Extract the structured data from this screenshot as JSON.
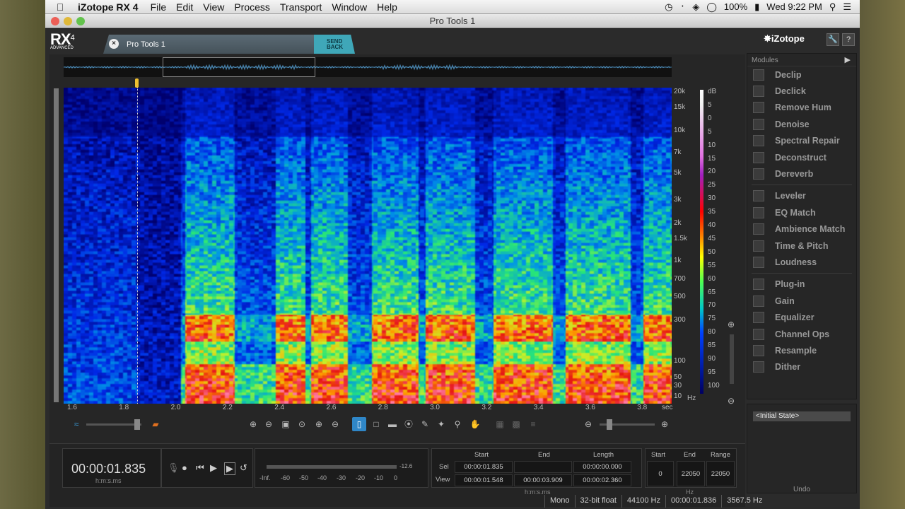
{
  "menubar": {
    "app": "iZotope RX 4",
    "items": [
      "File",
      "Edit",
      "View",
      "Process",
      "Transport",
      "Window",
      "Help"
    ],
    "battery": "100%",
    "clock": "Wed 9:22 PM"
  },
  "window": {
    "title": "Pro Tools 1"
  },
  "logo": {
    "text": "RX",
    "sup": "4",
    "sub": "ADVANCED"
  },
  "tab": {
    "label": "Pro Tools 1",
    "close": "×",
    "send_back": "SEND BACK"
  },
  "brand": "iZotope",
  "modules": {
    "header": "Modules",
    "groups": [
      [
        {
          "label": "Declip",
          "icon": "declip-icon"
        },
        {
          "label": "Declick",
          "icon": "declick-icon"
        },
        {
          "label": "Remove Hum",
          "icon": "hum-icon"
        },
        {
          "label": "Denoise",
          "icon": "denoise-icon"
        },
        {
          "label": "Spectral Repair",
          "icon": "repair-icon"
        },
        {
          "label": "Deconstruct",
          "icon": "deconstruct-icon"
        },
        {
          "label": "Dereverb",
          "icon": "dereverb-icon"
        }
      ],
      [
        {
          "label": "Leveler",
          "icon": "leveler-icon"
        },
        {
          "label": "EQ Match",
          "icon": "eq-match-icon"
        },
        {
          "label": "Ambience Match",
          "icon": "ambience-icon"
        },
        {
          "label": "Time & Pitch",
          "icon": "time-pitch-icon"
        },
        {
          "label": "Loudness",
          "icon": "loudness-icon"
        }
      ],
      [
        {
          "label": "Plug-in",
          "icon": "plugin-icon"
        },
        {
          "label": "Gain",
          "icon": "gain-icon"
        },
        {
          "label": "Equalizer",
          "icon": "equalizer-icon"
        },
        {
          "label": "Channel Ops",
          "icon": "channel-ops-icon"
        },
        {
          "label": "Resample",
          "icon": "resample-icon"
        },
        {
          "label": "Dither",
          "icon": "dither-icon"
        }
      ]
    ]
  },
  "undo": {
    "item": "<Initial State>",
    "label": "Undo"
  },
  "freq_axis": [
    "20k",
    "15k",
    "10k",
    "7k",
    "5k",
    "3k",
    "2k",
    "1.5k",
    "1k",
    "700",
    "500",
    "300",
    "100",
    "50",
    "30",
    "10",
    "Hz"
  ],
  "db_axis": [
    "dB",
    "5",
    "0",
    "5",
    "10",
    "15",
    "20",
    "25",
    "30",
    "35",
    "40",
    "45",
    "50",
    "55",
    "60",
    "65",
    "70",
    "75",
    "80",
    "85",
    "90",
    "95",
    "100"
  ],
  "time_axis": [
    "1.6",
    "1.8",
    "2.0",
    "2.2",
    "2.4",
    "2.6",
    "2.8",
    "3.0",
    "3.2",
    "3.4",
    "3.6",
    "3.8",
    "sec"
  ],
  "transport": {
    "time": "00:00:01.835",
    "time_unit": "h:m:s.ms",
    "meter_ticks": [
      "-Inf.",
      "-60",
      "-50",
      "-40",
      "-30",
      "-20",
      "-10",
      "0"
    ],
    "meter_peak": "-12.6"
  },
  "selection": {
    "headers": [
      "Start",
      "End",
      "Length"
    ],
    "sel_label": "Sel",
    "view_label": "View",
    "sel": [
      "00:00:01.835",
      "",
      "00:00:00.000"
    ],
    "view": [
      "00:00:01.548",
      "00:00:03.909",
      "00:00:02.360"
    ],
    "unit": "h:m:s.ms"
  },
  "range": {
    "headers": [
      "Start",
      "End",
      "Range"
    ],
    "values": [
      "0",
      "22050",
      "22050"
    ],
    "unit": "Hz"
  },
  "status": [
    "Mono",
    "32-bit float",
    "44100 Hz",
    "00:00:01.836",
    "3567.5 Hz"
  ]
}
